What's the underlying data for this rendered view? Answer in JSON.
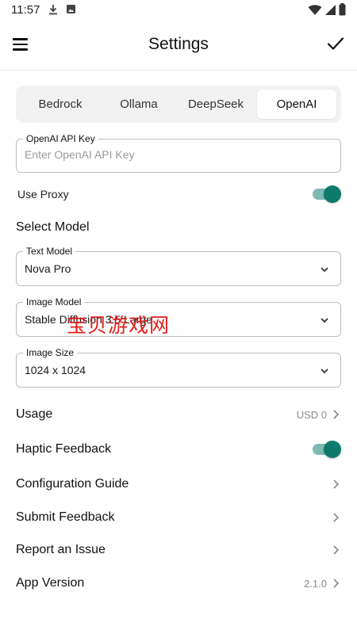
{
  "status_bar": {
    "time": "11:57",
    "icons": [
      "download-icon",
      "photo-icon",
      "wifi-icon",
      "signal-icon",
      "battery-icon"
    ]
  },
  "appbar": {
    "title": "Settings",
    "menu_icon": "menu-icon",
    "confirm_icon": "check-icon"
  },
  "providers": {
    "tabs": [
      "Bedrock",
      "Ollama",
      "DeepSeek",
      "OpenAI"
    ],
    "selected": "OpenAI"
  },
  "api_key": {
    "label": "OpenAI API Key",
    "value": "",
    "placeholder": "Enter OpenAI API Key"
  },
  "use_proxy": {
    "label": "Use Proxy",
    "enabled": true
  },
  "select_model": {
    "title": "Select Model",
    "text_model": {
      "label": "Text Model",
      "value": "Nova Pro"
    },
    "image_model": {
      "label": "Image Model",
      "value": "Stable Diffusion 3.5 Large"
    },
    "image_size": {
      "label": "Image Size",
      "value": "1024 x 1024"
    }
  },
  "usage": {
    "label": "Usage",
    "value": "USD 0"
  },
  "haptic": {
    "label": "Haptic Feedback",
    "enabled": true
  },
  "menu_rows": [
    {
      "label": "Configuration Guide"
    },
    {
      "label": "Submit Feedback"
    },
    {
      "label": "Report an Issue"
    }
  ],
  "app_version": {
    "label": "App Version",
    "value": "2.1.0"
  },
  "watermark": "宝贝游戏网",
  "colors": {
    "accent": "#0d7a6c",
    "accent_track": "#7fb9b2",
    "watermark": "#e0201b"
  }
}
